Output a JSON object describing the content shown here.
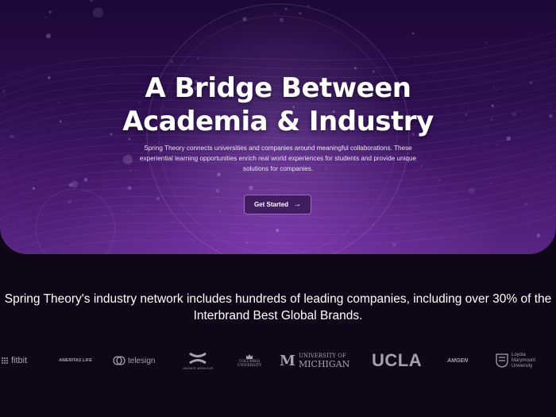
{
  "hero": {
    "title_line1": "A Bridge Between",
    "title_line2": "Academia & Industry",
    "description": "Spring Theory connects universities and companies around meaningful collaborations. These experiential learning opportunities enrich real world experiences for students and provide unique solutions for companies.",
    "cta_label": "Get Started",
    "cta_icon": "arrow-right-icon"
  },
  "network_text": "Spring Theory's industry network includes hundreds of leading companies, including over 30% of the Interbrand Best Global Brands.",
  "logos": {
    "fitbit": "fitbit",
    "ameritas": "AMERITAS LIFE",
    "telesign": "telesign",
    "under_armour": "UNDER ARMOUR",
    "columbia": "COLUMBIA UNIVERSITY",
    "michigan_top": "UNIVERSITY OF",
    "michigan_bottom": "MICHIGAN",
    "ucla": "UCLA",
    "amgen": "AMGEN",
    "lmu": "Loyola Marymount University"
  },
  "colors": {
    "page_bg": "#0f0617",
    "hero_top": "#1d0838",
    "hero_bottom": "#5a2585",
    "logo_gray": "#a7a0ad"
  }
}
